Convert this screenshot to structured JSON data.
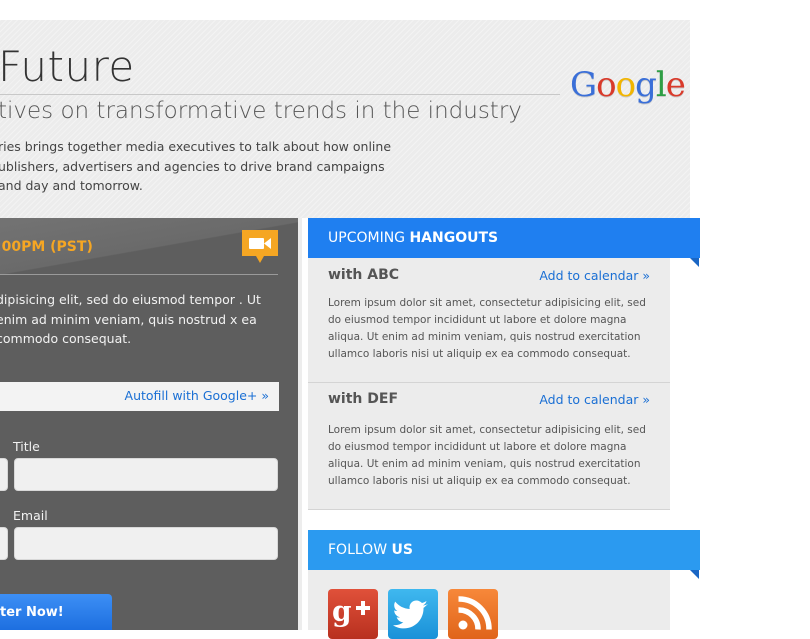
{
  "header": {
    "title": "Future",
    "subtitle": "tives on transformative trends in the industry",
    "intro": "ries brings together media executives to talk about how online ublishers, advertisers and agencies to drive brand campaigns and day and tomorrow.",
    "logo_text": "Google"
  },
  "registration": {
    "time": ":00PM (PST)",
    "camera_icon": "video-camera-icon",
    "description": "dipisicing elit, sed do eiusmod tempor . Ut enim ad minim veniam, quis nostrud x ea commodo consequat.",
    "autofill_label": "Autofill with Google+  »",
    "fields": {
      "title_label": "Title",
      "email_label": "Email"
    },
    "register_label": "ter Now!"
  },
  "hangouts": {
    "header_prefix": "UPCOMING ",
    "header_strong": "HANGOUTS",
    "items": [
      {
        "title": "with ABC",
        "cta": "Add to calendar »",
        "description": "Lorem ipsum dolor sit amet, consectetur adipisicing elit, sed do eiusmod tempor incididunt ut labore et dolore magna aliqua. Ut enim ad minim veniam, quis nostrud exercitation ullamco laboris nisi ut aliquip ex ea commodo consequat."
      },
      {
        "title": "with DEF",
        "cta": "Add to calendar »",
        "description": "Lorem ipsum dolor sit amet, consectetur adipisicing elit, sed do eiusmod tempor incididunt ut labore et dolore magna aliqua. Ut enim ad minim veniam, quis nostrud exercitation ullamco laboris nisi ut aliquip ex ea commodo consequat."
      }
    ]
  },
  "follow": {
    "header_prefix": "FOLLOW ",
    "header_strong": "US",
    "icons": [
      "google-plus-icon",
      "twitter-icon",
      "rss-icon"
    ]
  },
  "colors": {
    "accent_blue": "#1a6fd4",
    "hangouts_header": "#1f7ff0",
    "follow_header": "#2b9af0",
    "time_orange": "#f5a623",
    "panel_dark": "#5e5e5e"
  }
}
